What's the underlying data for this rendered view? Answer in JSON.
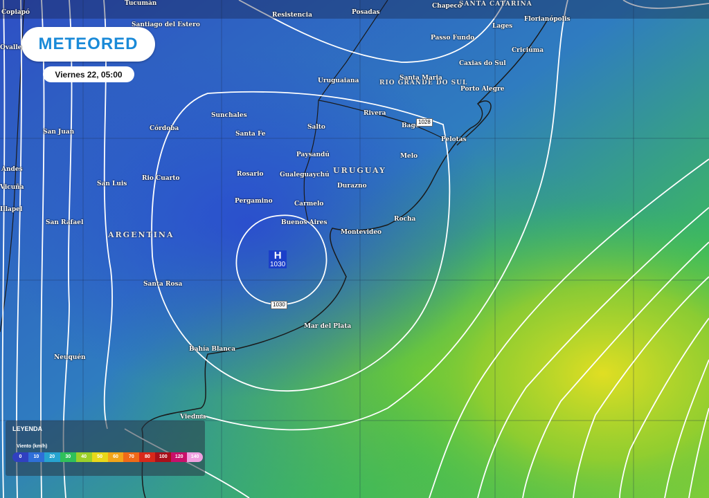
{
  "brand": {
    "name": "METEORED",
    "accent": "#1a8ad8"
  },
  "datetime": "Viernes 22, 05:00",
  "countries": [
    {
      "name": "ARGENTINA"
    },
    {
      "name": "URUGUAY"
    },
    {
      "name": "RIO GRANDE DO SUL"
    },
    {
      "name": "SANTA CATARINA"
    }
  ],
  "places": [
    "Copiapó",
    "Tucumán",
    "Santiago del Estero",
    "Resistencia",
    "Posadas",
    "Chapecó",
    "Florianópolis",
    "Passo Fundo",
    "Lages",
    "Criciúma",
    "Caxias do Sul",
    "Santa Maria",
    "Porto Alegre",
    "Uruguaiana",
    "Sunchales",
    "Córdoba",
    "Santa Fe",
    "Salto",
    "Rivera",
    "Bagé",
    "Pelotas",
    "San Juan",
    "Paysandú",
    "Melo",
    "Andes",
    "Rosario",
    "Gualeguaychú",
    "Rio Cuarto",
    "San Luis",
    "Durazno",
    "Pergamino",
    "Carmelo",
    "San Rafael",
    "Buenos Aires",
    "Rocha",
    "Montevideo",
    "Santa Rosa",
    "Mar del Plata",
    "Bahía Blanca",
    "Neuquén",
    "Viedma",
    "Copiapó",
    "Ovalle",
    "Vicuña",
    "Illapel"
  ],
  "isobar_labels": [
    "1028",
    "1030"
  ],
  "pressure_center": {
    "letter": "H",
    "value": "1030"
  },
  "legend": {
    "title": "LEYENDA",
    "unit": "Viento (km/h)",
    "stops": [
      {
        "label": "0",
        "color": "#3040c0"
      },
      {
        "label": "10",
        "color": "#2f6fd8"
      },
      {
        "label": "20",
        "color": "#27a4d0"
      },
      {
        "label": "30",
        "color": "#2fc05a"
      },
      {
        "label": "40",
        "color": "#9bd02a"
      },
      {
        "label": "50",
        "color": "#e8d81a"
      },
      {
        "label": "60",
        "color": "#f2a51a"
      },
      {
        "label": "70",
        "color": "#f06a18"
      },
      {
        "label": "80",
        "color": "#d8281a"
      },
      {
        "label": "100",
        "color": "#a8101a"
      },
      {
        "label": "120",
        "color": "#c8106a"
      },
      {
        "label": "140",
        "color": "#f0a0e0"
      }
    ]
  }
}
